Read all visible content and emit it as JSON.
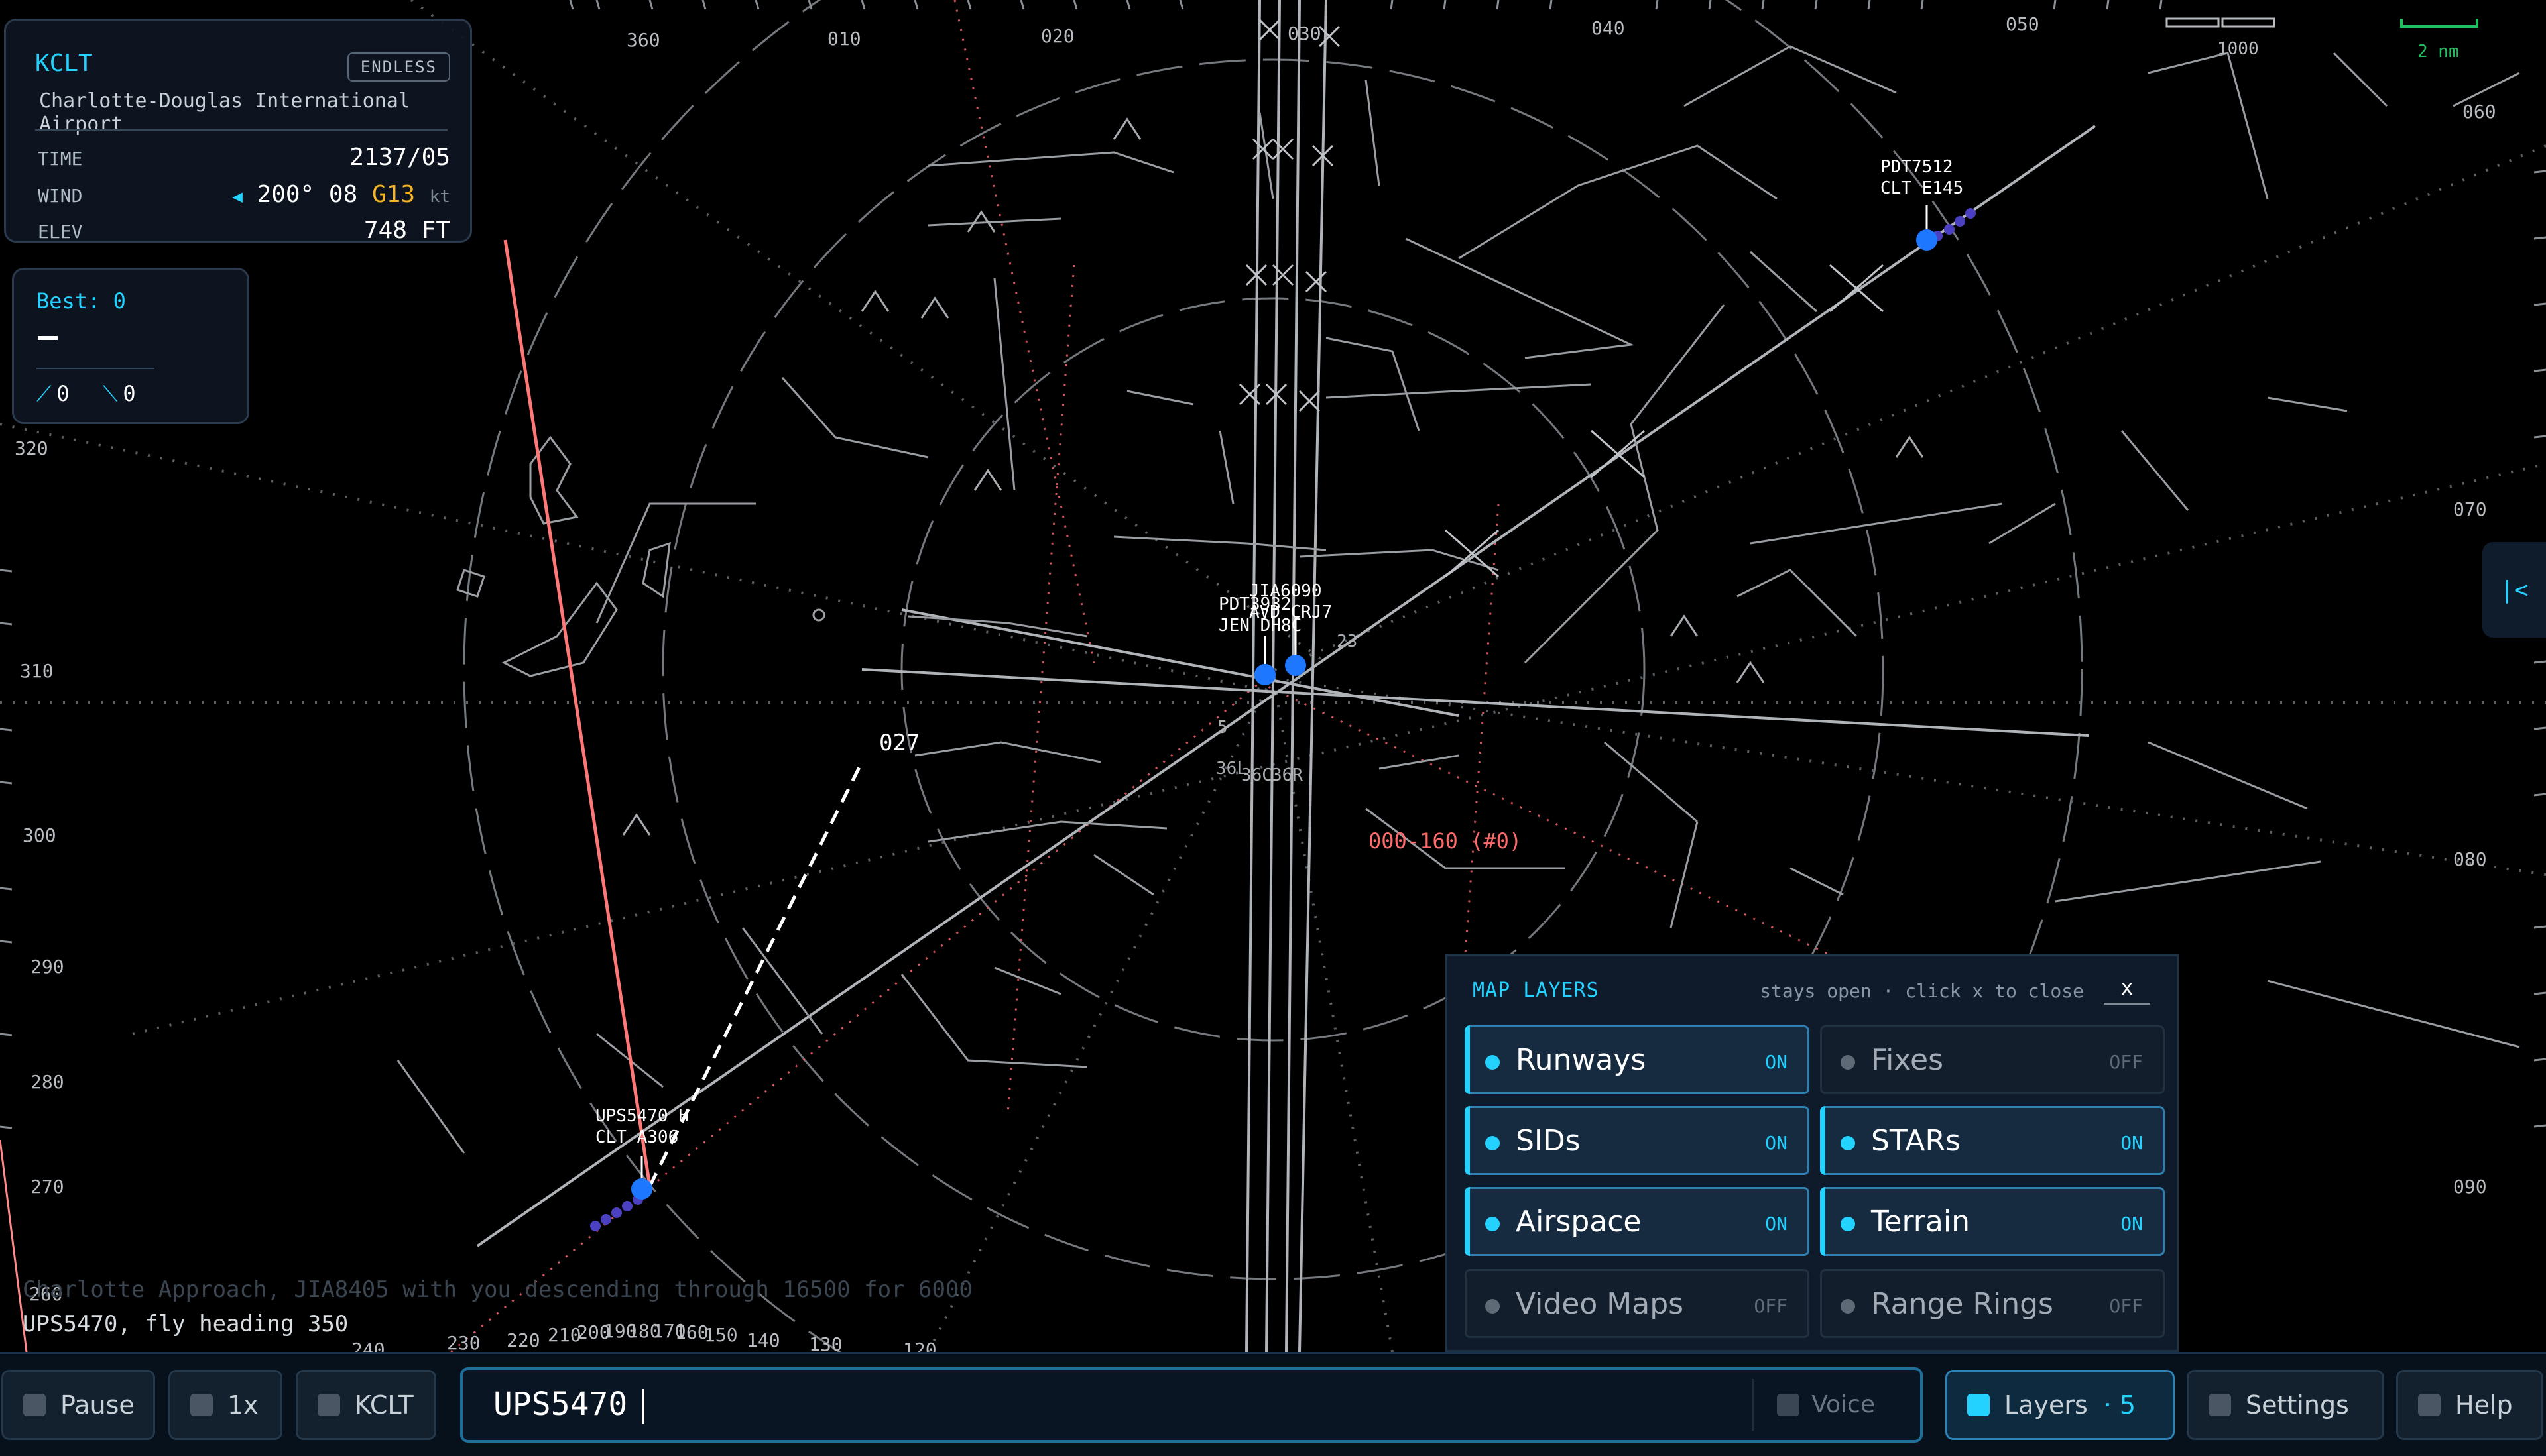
{
  "airport": {
    "icao": "KCLT",
    "mode_badge": "ENDLESS",
    "name": "Charlotte-Douglas International Airport",
    "time_label": "TIME",
    "time_value": "2137/05",
    "wind_label": "WIND",
    "wind_dir": "200°",
    "wind_speed": "08",
    "wind_gust": "G13",
    "wind_unit": "kt",
    "elev_label": "ELEV",
    "elev_value": "748 FT"
  },
  "best": {
    "label": "Best: 0",
    "departures": "0",
    "arrivals": "0"
  },
  "scale": {
    "distance": "2 nm",
    "altitude_mark": "1000"
  },
  "compass": {
    "top": [
      "360",
      "010",
      "020",
      "030",
      "040",
      "050"
    ],
    "right": [
      "060",
      "070",
      "080",
      "090"
    ],
    "left": [
      "320",
      "310",
      "300",
      "290",
      "280",
      "270",
      "260"
    ],
    "bottom": [
      "240",
      "230",
      "220",
      "210",
      "200",
      "190",
      "180",
      "170",
      "160",
      "150",
      "140",
      "130",
      "120"
    ]
  },
  "aircraft": [
    {
      "callsign": "PDT7512",
      "info": "CLT E145"
    },
    {
      "callsign": "UPS5470 H",
      "info": "CLT A306"
    },
    {
      "callsign": "JIA6090",
      "info": "AVD CRJ7"
    },
    {
      "callsign": "PDT3932",
      "info": "JEN DH8C"
    }
  ],
  "runway_labels": [
    "36L",
    "36C",
    "36R",
    "23",
    "5"
  ],
  "heading_marker": "027",
  "restriction_label": "000-160 (#0)",
  "log": [
    "Charlotte Approach, JIA8405 with you descending through 16500 for 6000",
    "UPS5470, fly heading 350"
  ],
  "map_layers": {
    "title": "MAP LAYERS",
    "hint": "stays open · click x to close",
    "close": "x",
    "items": [
      {
        "label": "Runways",
        "state": "ON"
      },
      {
        "label": "Fixes",
        "state": "OFF"
      },
      {
        "label": "SIDs",
        "state": "ON"
      },
      {
        "label": "STARs",
        "state": "ON"
      },
      {
        "label": "Airspace",
        "state": "ON"
      },
      {
        "label": "Terrain",
        "state": "ON"
      },
      {
        "label": "Video Maps",
        "state": "OFF"
      },
      {
        "label": "Range Rings",
        "state": "OFF"
      }
    ]
  },
  "toolbar": {
    "pause": "Pause",
    "speed": "1x",
    "airport": "KCLT",
    "command_text": "UPS5470",
    "voice": "Voice",
    "layers": "Layers",
    "layers_count": "· 5",
    "settings": "Settings",
    "help": "Help"
  },
  "edge_tab_icon": "|<",
  "colors": {
    "accent": "#24d2ff",
    "gust": "#f5b221",
    "restriction": "#ff6b6b",
    "aircraft": "#1e78ff"
  }
}
